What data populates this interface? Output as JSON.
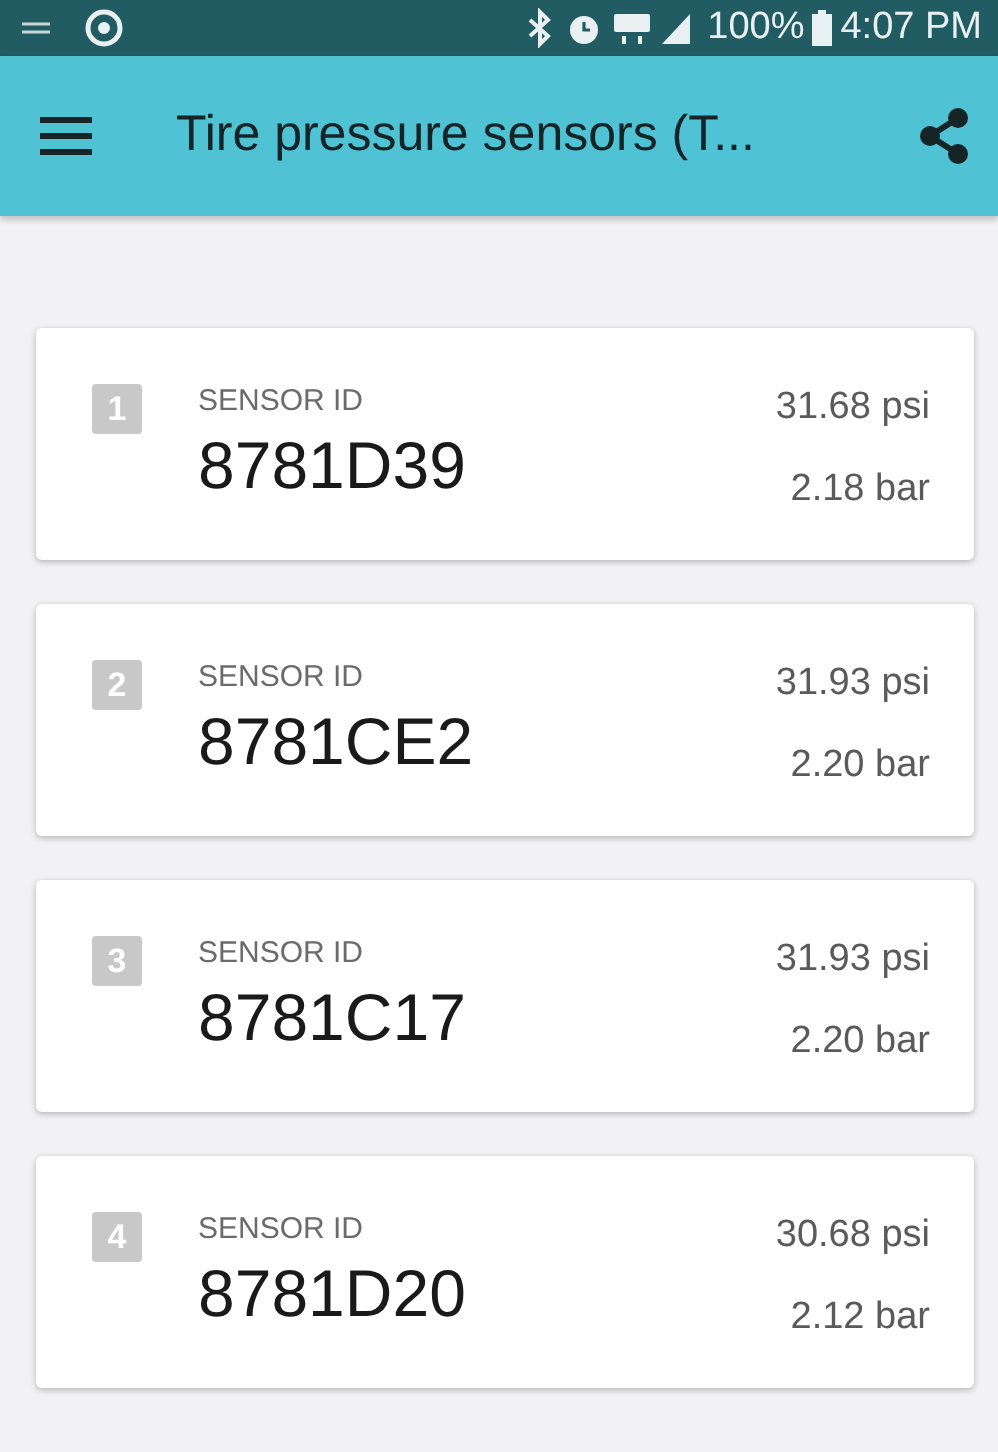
{
  "status_bar": {
    "battery": "100%",
    "time": "4:07 PM"
  },
  "app_bar": {
    "title": "Tire pressure sensors (T..."
  },
  "sensors": [
    {
      "index": "1",
      "label": "SENSOR ID",
      "id": "8781D39",
      "psi": "31.68 psi",
      "bar": "2.18 bar"
    },
    {
      "index": "2",
      "label": "SENSOR ID",
      "id": "8781CE2",
      "psi": "31.93 psi",
      "bar": "2.20 bar"
    },
    {
      "index": "3",
      "label": "SENSOR ID",
      "id": "8781C17",
      "psi": "31.93 psi",
      "bar": "2.20 bar"
    },
    {
      "index": "4",
      "label": "SENSOR ID",
      "id": "8781D20",
      "psi": "30.68 psi",
      "bar": "2.12 bar"
    }
  ]
}
